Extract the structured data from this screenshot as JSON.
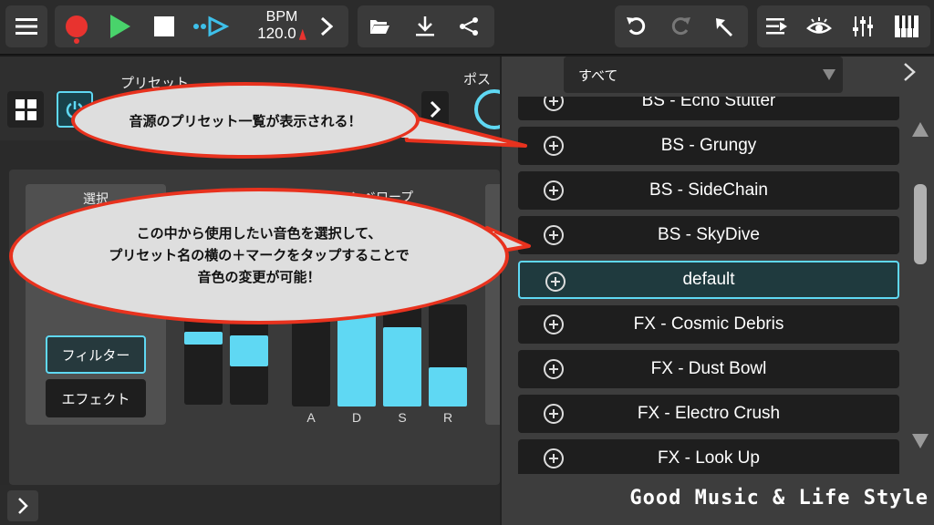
{
  "toolbar": {
    "bpm_label": "BPM",
    "bpm_value": "120.0"
  },
  "synth": {
    "preset_label": "プリセット",
    "position_label": "ポス",
    "select_title": "選択",
    "select_buttons": [
      "フィルター",
      "エフェクト"
    ],
    "envelope_title": "エンベロープ",
    "adsr": [
      {
        "label": "A",
        "level": 0.0
      },
      {
        "label": "D",
        "level": 0.95
      },
      {
        "label": "S",
        "level": 0.78
      },
      {
        "label": "R",
        "level": 0.38
      }
    ]
  },
  "browser": {
    "filter_value": "すべて",
    "presets": [
      {
        "name": "BS - Echo Stutter",
        "selected": false
      },
      {
        "name": "BS - Grungy",
        "selected": false
      },
      {
        "name": "BS - SideChain",
        "selected": false
      },
      {
        "name": "BS - SkyDive",
        "selected": false
      },
      {
        "name": "default",
        "selected": true
      },
      {
        "name": "FX - Cosmic Debris",
        "selected": false
      },
      {
        "name": "FX - Dust Bowl",
        "selected": false
      },
      {
        "name": "FX - Electro Crush",
        "selected": false
      },
      {
        "name": "FX - Look Up",
        "selected": false
      }
    ]
  },
  "annotations": {
    "bubble1": "音源のプリセット一覧が表示される！",
    "bubble2_lines": [
      "この中から使用したい音色を選択して、",
      "プリセット名の横の＋マークをタップすることで",
      "音色の変更が可能！"
    ]
  },
  "watermark": "Good Music & Life Style",
  "colors": {
    "accent": "#5fd8f3",
    "record": "#e8332f",
    "play": "#49d36b",
    "bubble_border": "#e8321e"
  }
}
